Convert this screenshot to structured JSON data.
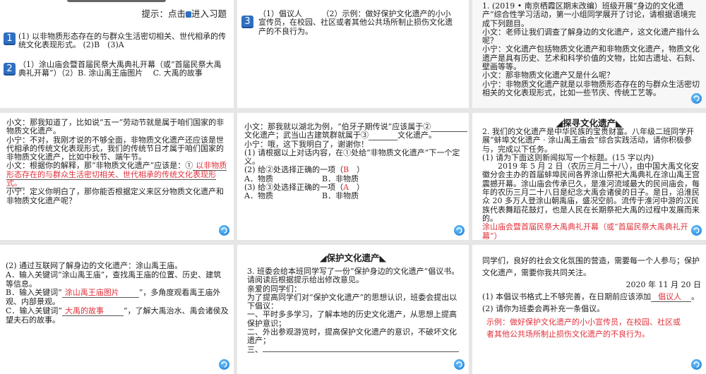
{
  "hint": {
    "prefix": "提示：点击",
    "suffix": "进入习题"
  },
  "answers": [
    {
      "num": "1",
      "text": "(1) 以非物质形态存在的与群众生活密切相关、世代相承的传统文化表现形式。 (2)B　(3)A"
    },
    {
      "num": "2",
      "text": "（1）涂山庙会暨首届民祭大禹典礼开幕（或“首届民祭大禹典礼开幕”）（2）B. 涂山禹王庙图片　 C. 大禹的故事"
    },
    {
      "num": "3",
      "text": "（1）倡议人　　　（2）示例：做好保护文化遗产的小小宣传员，在校园、社区或者其他公共场所制止损伤文化遗产的不良行为。"
    }
  ],
  "slide3": {
    "lines": [
      "1. (2019 • 南京栖霞区期末改编）班级开展“身边的文化遗产”综合性学习活动，第一小组同学展开了讨论，请根据语境完成下列题目。",
      "小文：老师让我们调查了解身边的文化遗产，这文化遗产指什么呢？",
      "小宁：文化遗产包括物质文化遗产和非物质文化遗产，物质文化遗产是具有历史、艺术和科学价值的文物，比如古遗址、石刻、壁画等等。",
      "小文：那非物质文化遗产又是什么呢？",
      "小宁：非物质文化遗产就是以非物质形态存在的与群众生活密切相关的文化表现形式，比如一些节庆、传统工艺等。"
    ]
  },
  "slide4": {
    "l1": "小文：那我知道了，比如说“五一”劳动节就是属于咱们国家的非物质文化遗产。",
    "l2": "小宁：不对，我刚才说的不够全面，非物质文化遗产还应该是世代相承的传统文化表现形式，我们的传统节日才属于咱们国家的非物质文化遗产，比如中秋节、端午节。",
    "l3": "小文：根据你的解释，那“非物质文化遗产”应该是：①",
    "answer": "以非物质形态存在的与群众生活密切相关、世代相承的传统文化表现形式。",
    "l4": "小宁：定义你明白了，那你能否根据定义来区分物质文化遗产和非物质文化遗产呢？"
  },
  "slide5": {
    "l1a": "小文：那我就以湖北为例，“伯牙子期传说”应该属于②",
    "l1b": "文化遗产；武当山古建筑群就属于③",
    "l1c": "文化遗产。",
    "l2": "小宁：哦，这下我明白了，谢谢你！",
    "q1": "(1) 请根据以上对话内容，在①处给“非物质文化遗产”下一个定义。",
    "q2": "(2) 给②处选择正确的一项（",
    "q2ans": "B",
    "q3": "(3) 给③处选择正确的一项（",
    "q3ans": "A",
    "close": "）",
    "optA": "A．物质",
    "optB": "B．非物质"
  },
  "slide6": {
    "section": "◢探寻文化遗产◣",
    "intro": "2. 我们的文化遗产是中华民族的宝贵财富。八年级二班同学开展“蚌埠文化遗产 · 涂山禹王庙会”综合实践活动，请你积极参与，完成以下任务。",
    "q1": "(1) 请为下面这则新闻拟写一个标题。(15 字以内)",
    "news": "2019 年 5 月 2 日（农历三月二十八），由中国大禹文化安徽分会主办的首届蚌埠民间各界涂山祭祀大禹典礼在涂山禹王宫震撼开幕。涂山庙会传承已久，是淮河流域最大的民间庙会，每年的农历三月二十八日是纪念大禹会诸侯的日子。是日，沿淮民众 20 多万人登涂山朝禹庙，盛况空前。流传于淮河中游的汉民族代表舞蹈花鼓灯，也是人民在长期祭祀大禹的过程中发展而来的。",
    "answer": "涂山庙会暨首届民祭大禹典礼开幕（或“首届民祭大禹典礼开幕”）"
  },
  "slide7": {
    "q2": "(2) 通过互联网了解身边的文化遗产：涂山禹王庙。",
    "a": "A．输入关键词“涂山禹王庙”，查找禹王庙的位置、历史、建筑等信息。",
    "b1": "B．输入关键词“",
    "bans": "涂山禹王庙图片",
    "b2": "”，多角度观看禹王庙外观、内部景观。",
    "c1": "C．输入关键词“",
    "cans": "大禹的故事",
    "c2": "”，了解大禹治水、禹会诸侯及望夫石的故事。"
  },
  "slide8": {
    "section": "◢保护文化遗产◣",
    "lines": [
      "3. 班委会给本班同学写了一份“保护身边的文化遗产”倡议书。请阅读后根据提示给出修改意见。",
      "亲爱的同学们：",
      "为了提高同学们对“保护文化遗产”的思想认识，班委会提出以下倡议：",
      "一、平时多多学习，了解本地的历史文化遗产，从思想上提高保护意识；",
      "二、外出参观游览时，提高保护文化遗产的意识，不破坏文化遗产；"
    ],
    "three": "三、"
  },
  "slide9": {
    "l1": "同学们，良好的社会文化氛围的营造，需要每一个人参与；保护文化遗产，需要你我共同关注。",
    "date": "2020 年 11 月 20 日",
    "q1": "(1) 本倡议书格式上不够完善，在日期前应该添加",
    "q1ans": "倡议人",
    "q1end": "。",
    "q2": "(2) 请你为班委会再补充一条倡议。",
    "answer": "示例：做好保护文化遗产的小小宣传员，在校园、社区或者其他公共场所制止损伤文化遗产的不良行为。"
  }
}
